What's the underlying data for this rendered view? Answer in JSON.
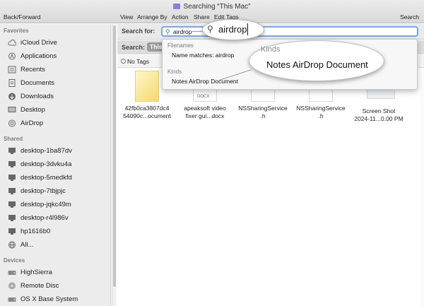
{
  "window": {
    "title": "Searching “This Mac”"
  },
  "toolbar": {
    "back_forward": "Back/Forward",
    "menus": [
      "View",
      "Arrange By",
      "Action",
      "Share",
      "Edit Tags"
    ],
    "search": "Search"
  },
  "sidebar": {
    "favorites_header": "Favorites",
    "favorites": [
      {
        "label": "iCloud Drive",
        "icon": "cloud-icon"
      },
      {
        "label": "Applications",
        "icon": "applications-icon"
      },
      {
        "label": "Recents",
        "icon": "recents-icon"
      },
      {
        "label": "Documents",
        "icon": "documents-icon"
      },
      {
        "label": "Downloads",
        "icon": "downloads-icon"
      },
      {
        "label": "Desktop",
        "icon": "desktop-icon"
      },
      {
        "label": "AirDrop",
        "icon": "airdrop-icon"
      }
    ],
    "shared_header": "Shared",
    "shared": [
      "desktop-1ba87dv",
      "desktop-3dvku4a",
      "desktop-5medkfd",
      "desktop-7tbjpjc",
      "desktop-jqkc49m",
      "desktop-r4l986v",
      "hp1616b0",
      "All..."
    ],
    "devices_header": "Devices",
    "devices": [
      {
        "label": "HighSierra",
        "icon": "hard-disk-icon"
      },
      {
        "label": "Remote Disc",
        "icon": "remote-disc-icon"
      },
      {
        "label": "OS X Base System",
        "icon": "hard-disk-icon"
      }
    ]
  },
  "search": {
    "label": "Search for:",
    "value": "airdrop",
    "scope_label": "Search:",
    "scope_value": "This"
  },
  "tags": {
    "label": "No Tags"
  },
  "dropdown": {
    "filenames_header": "Filenames",
    "name_matches": "Name matches: airdrop",
    "kinds_header": "Kinds",
    "kind_item": "Notes AirDrop Document"
  },
  "magnifier": {
    "search_text": "airdrop",
    "kinds_label": "Kinds",
    "kind_item": "Notes AirDrop Document"
  },
  "files": [
    {
      "line1": "42fb0ca3807dc4",
      "line2": "54090c...ocument",
      "type": "notes-doc"
    },
    {
      "line1": "apeaksoft video",
      "line2": "fixer gui...docx",
      "type": "docx"
    },
    {
      "line1": "NSSharingService",
      "line2": ".h",
      "type": "h"
    },
    {
      "line1": "NSSharingService",
      "line2": ".h",
      "type": "h"
    },
    {
      "line1": "Screen Shot",
      "line2": "2024-11...0.00 PM",
      "type": "screenshot"
    }
  ],
  "badges": {
    "h": ".h",
    "docx": "DOCX"
  },
  "colors": {
    "accent": "#7aa7e6",
    "sidebar_bg": "#ececec",
    "h_badge": "#b1314b"
  }
}
